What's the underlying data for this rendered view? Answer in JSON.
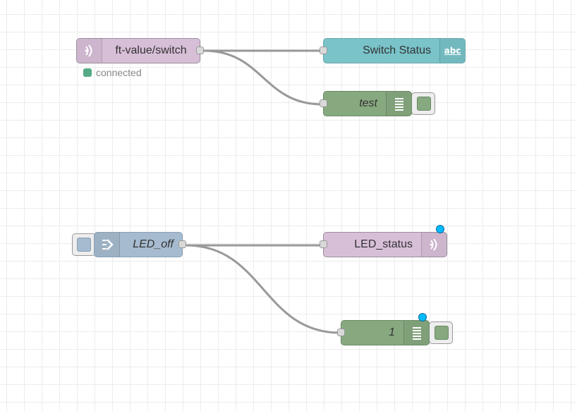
{
  "colors": {
    "mqtt_node": "#d8bfd8",
    "ui_text_node": "#79c3c9",
    "debug_node": "#87a980",
    "link_node": "#a6bbcf",
    "wire": "#999999",
    "changed_marker": "#00bcff",
    "status_connected": "#5a8"
  },
  "nodes": {
    "mqtt_in": {
      "label": "ft-value/switch",
      "icon": "wifi-icon"
    },
    "mqtt_in_status": {
      "text": "connected"
    },
    "ui_text": {
      "label": "Switch Status",
      "icon": "abc-icon",
      "icon_text": "abc"
    },
    "debug_test": {
      "label": "test",
      "icon": "list-icon"
    },
    "inject": {
      "label": "LED_off",
      "icon": "arrow-right-icon"
    },
    "mqtt_out": {
      "label": "LED_status",
      "icon": "wifi-icon"
    },
    "debug_1": {
      "label": "1",
      "icon": "list-icon"
    }
  }
}
